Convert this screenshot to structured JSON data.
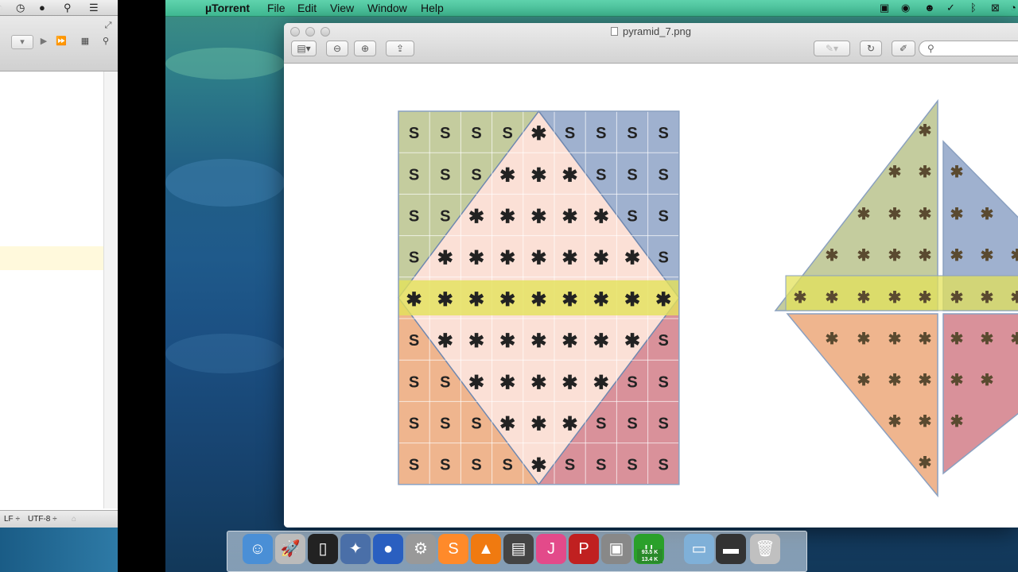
{
  "menubar": {
    "app_name": "µTorrent",
    "items": [
      "File",
      "Edit",
      "View",
      "Window",
      "Help"
    ],
    "status_icons": [
      "screen-record-icon",
      "camera-icon",
      "alien-icon",
      "checkmark-brush-icon",
      "bluetooth-icon",
      "box-x-icon"
    ]
  },
  "left_pane": {
    "status": {
      "line_ending": "LF ÷",
      "encoding": "UTF-8 ÷"
    }
  },
  "window": {
    "title": "pyramid_7.png",
    "search_placeholder": ""
  },
  "figure": {
    "grid_rows": 9,
    "grid_cols": 9,
    "cell_s": "S",
    "cell_star": "✱",
    "grid": [
      [
        "S",
        "S",
        "S",
        "S",
        "*",
        "S",
        "S",
        "S",
        "S"
      ],
      [
        "S",
        "S",
        "S",
        "*",
        "*",
        "*",
        "S",
        "S",
        "S"
      ],
      [
        "S",
        "S",
        "*",
        "*",
        "*",
        "*",
        "*",
        "S",
        "S"
      ],
      [
        "S",
        "*",
        "*",
        "*",
        "*",
        "*",
        "*",
        "*",
        "S"
      ],
      [
        "*",
        "*",
        "*",
        "*",
        "*",
        "*",
        "*",
        "*",
        "*"
      ],
      [
        "S",
        "*",
        "*",
        "*",
        "*",
        "*",
        "*",
        "*",
        "S"
      ],
      [
        "S",
        "S",
        "*",
        "*",
        "*",
        "*",
        "*",
        "S",
        "S"
      ],
      [
        "S",
        "S",
        "S",
        "*",
        "*",
        "*",
        "S",
        "S",
        "S"
      ],
      [
        "S",
        "S",
        "S",
        "S",
        "*",
        "S",
        "S",
        "S",
        "S"
      ]
    ],
    "colors": {
      "green": "#c4cc9e",
      "blue": "#9fb1cf",
      "orange": "#efb58e",
      "red": "#d9919a",
      "center": "#fbe0d6",
      "yellow_band": "#e3e25a"
    }
  },
  "dock": {
    "icons": [
      "finder-icon",
      "rocket-launchpad-icon",
      "terminal-icon",
      "eagle-app-icon",
      "globe-icon",
      "system-prefs-gear-icon",
      "sublime-text-icon",
      "vlc-cone-icon",
      "clapperboard-icon",
      "jetbrains-icon",
      "pen-p-icon",
      "photo-preview-icon",
      "utorrent-icon",
      "folder-icon",
      "desktop-folder-icon",
      "trash-icon"
    ],
    "badge_top": "93.5 K",
    "badge_bottom": "13.4 K"
  }
}
